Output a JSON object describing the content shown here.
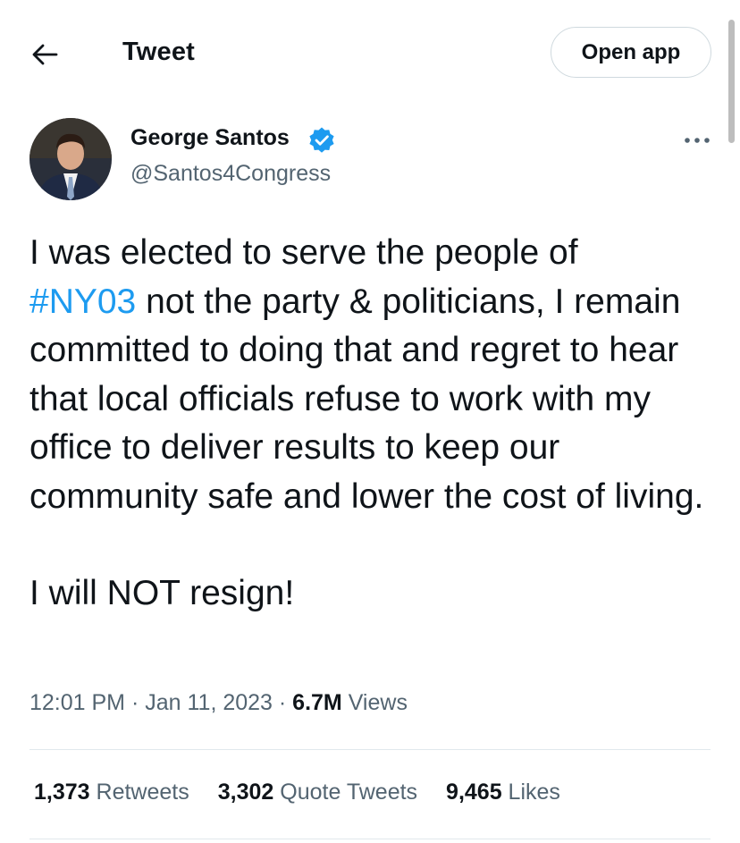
{
  "header": {
    "title": "Tweet",
    "open_app_label": "Open app"
  },
  "icons": {
    "back": "back-arrow-icon",
    "verified": "verified-badge-icon",
    "more": "more-options-icon"
  },
  "colors": {
    "hashtag": "#1d9bf0",
    "verified": "#1d9bf0",
    "secondary_text": "#536471"
  },
  "author": {
    "name": "George Santos",
    "handle": "@Santos4Congress"
  },
  "tweet": {
    "line1_before": "I was elected to serve the people of",
    "hashtag": "#NY03",
    "line1_after": " not the party & politicians, I remain committed to doing that and regret to hear that local officials refuse to work with my office to deliver results to keep our community safe and lower the cost of living.",
    "paragraph2": "I will NOT resign!"
  },
  "meta": {
    "time": "12:01 PM",
    "sep1": " · ",
    "date": "Jan 11, 2023",
    "sep2": " · ",
    "views_count": "6.7M",
    "views_label": " Views"
  },
  "stats": {
    "retweets_count": "1,373",
    "retweets_label": " Retweets",
    "quotes_count": "3,302",
    "quotes_label": " Quote Tweets",
    "likes_count": "9,465",
    "likes_label": " Likes"
  }
}
